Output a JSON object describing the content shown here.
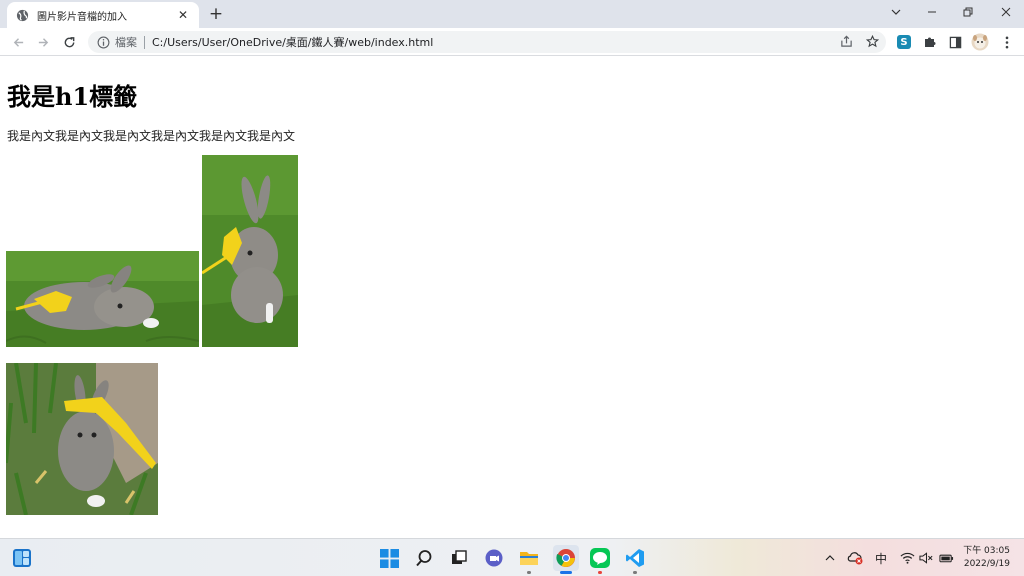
{
  "browser": {
    "tab_title": "圖片影片音檔的加入",
    "url_scheme_label": "檔案",
    "url": "C:/Users/User/OneDrive/桌面/鐵人賽/web/index.html",
    "extension_s_label": "S"
  },
  "page": {
    "heading": "我是h1標籤",
    "paragraph": "我是內文我是內文我是內文我是內文我是內文我是內文"
  },
  "taskbar": {
    "ime_label": "中",
    "time": "下午 03:05",
    "date": "2022/9/19"
  },
  "icons": {
    "favicon": "globe-icon",
    "tab_close": "close-icon",
    "new_tab": "plus-icon",
    "back": "arrow-left-icon",
    "forward": "arrow-right-icon",
    "reload": "reload-icon",
    "site_info": "info-icon",
    "share": "share-icon",
    "bookmark": "star-icon",
    "extensions": "puzzle-icon",
    "side_panel": "side-panel-icon",
    "menu": "kebab-menu-icon"
  },
  "colors": {
    "tabstrip_bg": "#dfe3eb",
    "omnibox_bg": "#f1f3f4",
    "grass": "#4f8a2a",
    "rabbit": "#8c8a86",
    "leash": "#f2d21b"
  }
}
